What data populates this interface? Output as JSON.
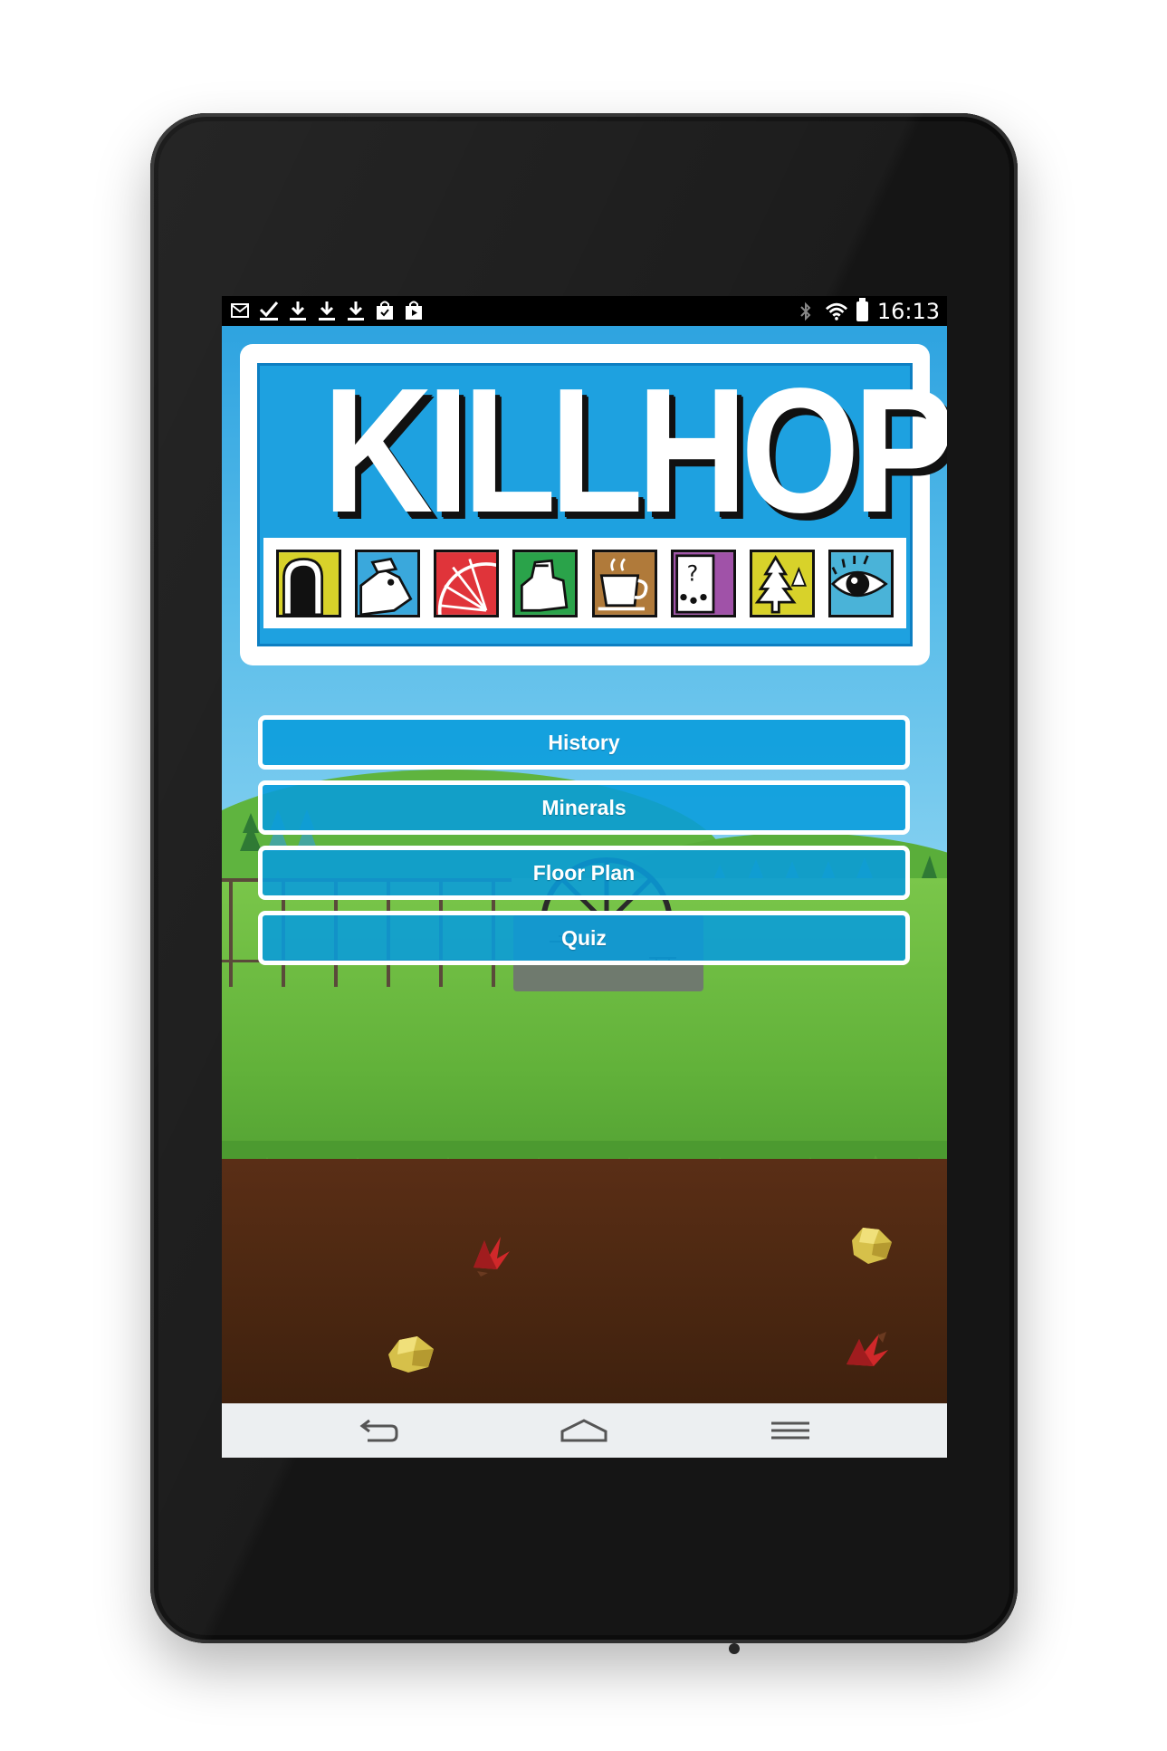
{
  "status_bar": {
    "left_icons": [
      "gmail-icon",
      "check-icon",
      "download-icon",
      "download-icon",
      "download-icon",
      "shopping-bag-icon",
      "play-store-icon"
    ],
    "right_icons": [
      "bluetooth-icon",
      "wifi-icon",
      "battery-icon"
    ],
    "time": "16:13"
  },
  "logo": {
    "title": "KILLHOPE",
    "tiles": [
      {
        "icon": "mine-entrance-icon",
        "color": "#d8d22a"
      },
      {
        "icon": "miner-icon",
        "color": "#3aa8dc"
      },
      {
        "icon": "water-wheel-icon",
        "color": "#e0343a"
      },
      {
        "icon": "shop-figure-icon",
        "color": "#2aa34a"
      },
      {
        "icon": "cafe-cup-icon",
        "color": "#b07a3a"
      },
      {
        "icon": "visitor-centre-icon",
        "color": "#a052a8"
      },
      {
        "icon": "woodland-icon",
        "color": "#d8d22a"
      },
      {
        "icon": "eye-icon",
        "color": "#4ab3d8"
      }
    ]
  },
  "menu": {
    "history": "History",
    "minerals": "Minerals",
    "floor_plan": "Floor Plan",
    "quiz": "Quiz"
  },
  "nav_bar": {
    "back": "back-icon",
    "home": "home-icon",
    "recents": "recents-icon"
  },
  "colors": {
    "sky": "#2ea3e0",
    "button": "#089cdc",
    "grass": "#6ab840",
    "soil": "#4f2912"
  }
}
